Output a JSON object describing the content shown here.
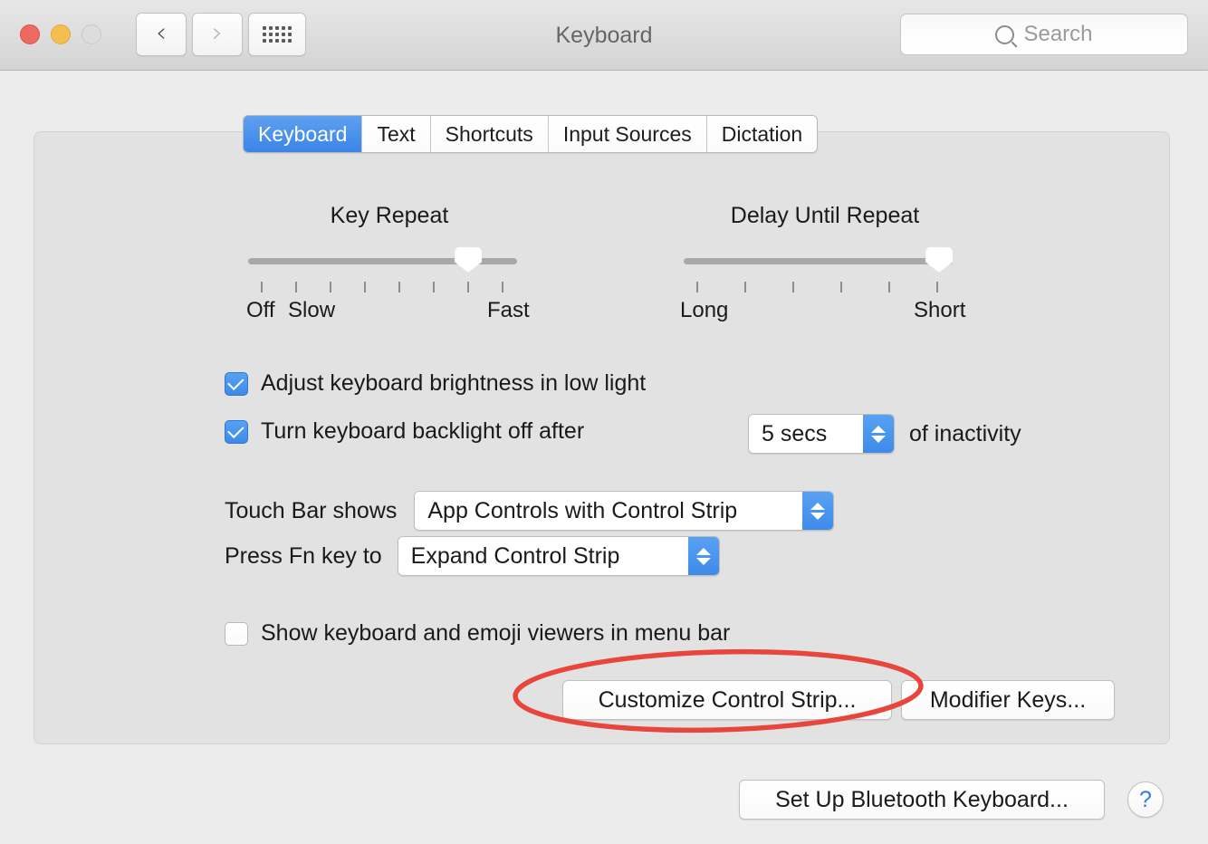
{
  "window": {
    "title": "Keyboard",
    "traffic_lights": [
      {
        "name": "close",
        "color": "#ec6a5e"
      },
      {
        "name": "minimize",
        "color": "#f5bf4f"
      },
      {
        "name": "maximize",
        "color": "#dddddd"
      }
    ],
    "nav": {
      "back": "‹",
      "forward": "›",
      "show_all": "grid-icon"
    },
    "search": {
      "placeholder": "Search",
      "value": ""
    }
  },
  "tabs": [
    {
      "label": "Keyboard",
      "active": true
    },
    {
      "label": "Text",
      "active": false
    },
    {
      "label": "Shortcuts",
      "active": false
    },
    {
      "label": "Input Sources",
      "active": false
    },
    {
      "label": "Dictation",
      "active": false
    }
  ],
  "sliders": [
    {
      "title": "Key Repeat",
      "ticks": 8,
      "thumb_index": 6,
      "labels": [
        {
          "text": "Off",
          "tick": 0
        },
        {
          "text": "Slow",
          "tick": 1
        },
        {
          "text": "Fast",
          "tick": 6
        }
      ]
    },
    {
      "title": "Delay Until Repeat",
      "ticks": 6,
      "thumb_index": 5,
      "labels": [
        {
          "text": "Long",
          "tick": 0
        },
        {
          "text": "Short",
          "tick": 5
        }
      ]
    }
  ],
  "checkboxes": [
    {
      "label": "Adjust keyboard brightness in low light",
      "checked": true
    },
    {
      "label": "Turn keyboard backlight off after",
      "checked": true
    },
    {
      "label": "Show keyboard and emoji viewers in menu bar",
      "checked": false
    }
  ],
  "backlight_timeout": {
    "value": "5 secs",
    "suffix": "of inactivity"
  },
  "popups": [
    {
      "label": "Touch Bar shows",
      "value": "App Controls with Control Strip"
    },
    {
      "label": "Press Fn key to",
      "value": "Expand Control Strip"
    }
  ],
  "buttons": {
    "customize_control_strip": "Customize Control Strip...",
    "modifier_keys": "Modifier Keys...",
    "set_up_bluetooth_keyboard": "Set Up Bluetooth Keyboard...",
    "help": "?"
  },
  "annotation": {
    "shape": "ellipse",
    "color": "#e8463c",
    "target": "Customize Control Strip..."
  }
}
